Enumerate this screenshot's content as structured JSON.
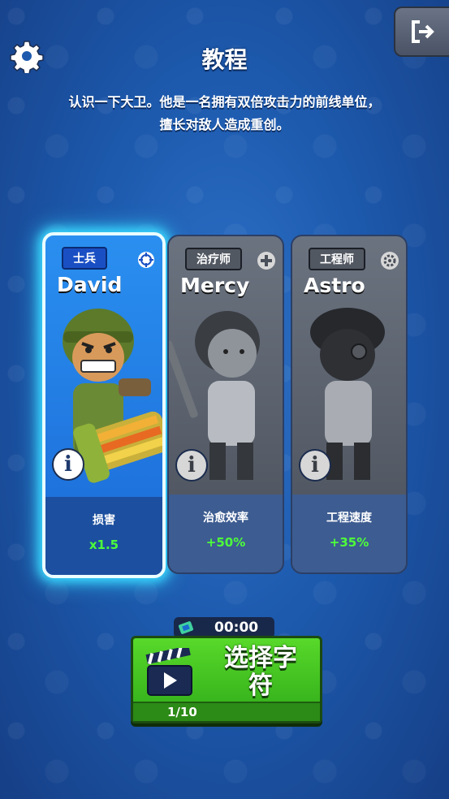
{
  "header": {
    "title": "教程",
    "description_line1": "认识一下大卫。他是一名拥有双倍攻击力的前线单位，",
    "description_line2": "擅长对敌人造成重创。",
    "settings_icon": "gear-icon",
    "exit_icon": "exit-icon"
  },
  "cards": [
    {
      "role": "士兵",
      "name": "David",
      "role_icon": "crosshair-icon",
      "stat_label": "损害",
      "stat_value": "x1.5",
      "selected": true
    },
    {
      "role": "治疗师",
      "name": "Mercy",
      "role_icon": "plus-icon",
      "stat_label": "治愈效率",
      "stat_value": "+50%",
      "selected": false
    },
    {
      "role": "工程师",
      "name": "Astro",
      "role_icon": "cog-icon",
      "stat_label": "工程速度",
      "stat_value": "+35%",
      "selected": false
    }
  ],
  "timer": {
    "value": "00:00",
    "icon": "ticket-icon"
  },
  "select_button": {
    "label_line1": "选择字",
    "label_line2": "符",
    "progress": "1/10",
    "icon": "clapperboard-video-icon"
  },
  "colors": {
    "accent_green": "#4dff3a",
    "button_green": "#3fc21f",
    "selected_glow": "#39d8ff"
  }
}
